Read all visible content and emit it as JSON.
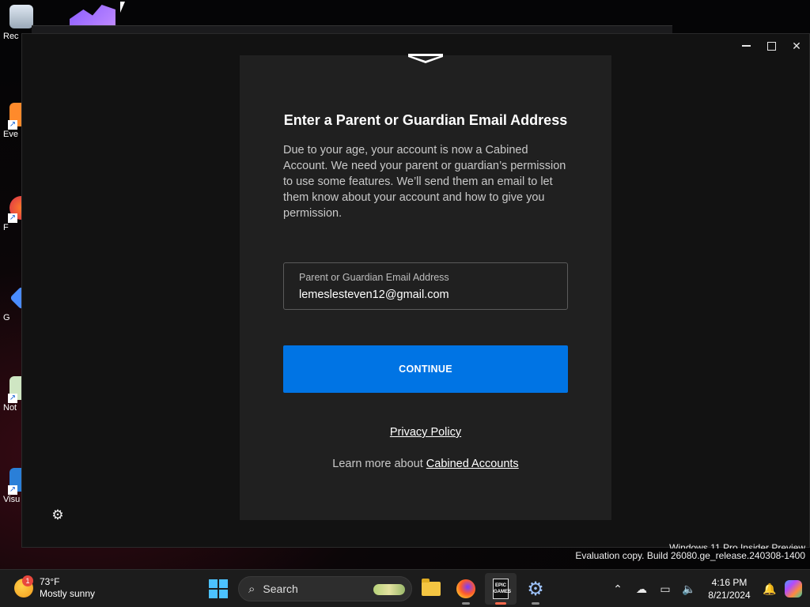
{
  "desktop": {
    "icons": [
      {
        "label": "Rec"
      },
      {
        "label": "Eve"
      },
      {
        "label": "F"
      },
      {
        "label": "G"
      },
      {
        "label": "Not"
      },
      {
        "label": "Visu"
      }
    ]
  },
  "dialog": {
    "title": "Enter a Parent or Guardian Email Address",
    "description": "Due to your age, your account is now a Cabined Account. We need your parent or guardian’s permission to use some features. We’ll send them an email to let them know about your account and how to give you permission.",
    "email_label": "Parent or Guardian Email Address",
    "email_value": "lemeslesteven12@gmail.com",
    "continue_label": "CONTINUE",
    "privacy_label": "Privacy Policy",
    "learn_prefix": "Learn more about",
    "learn_link": "Cabined Accounts"
  },
  "window_controls": {
    "close_glyph": "✕"
  },
  "watermark": {
    "line1": "Windows 11 Pro Insider Preview",
    "line2": "Evaluation copy. Build 26080.ge_release.240308-1400"
  },
  "taskbar": {
    "weather_temp": "73°F",
    "weather_desc": "Mostly sunny",
    "weather_badge": "1",
    "search_placeholder": "Search",
    "epic_label": "EPIC GAMES",
    "time": "4:16 PM",
    "date": "8/21/2024"
  },
  "colors": {
    "accent": "#0074e4",
    "card_bg": "#202020",
    "window_bg": "#121212"
  }
}
